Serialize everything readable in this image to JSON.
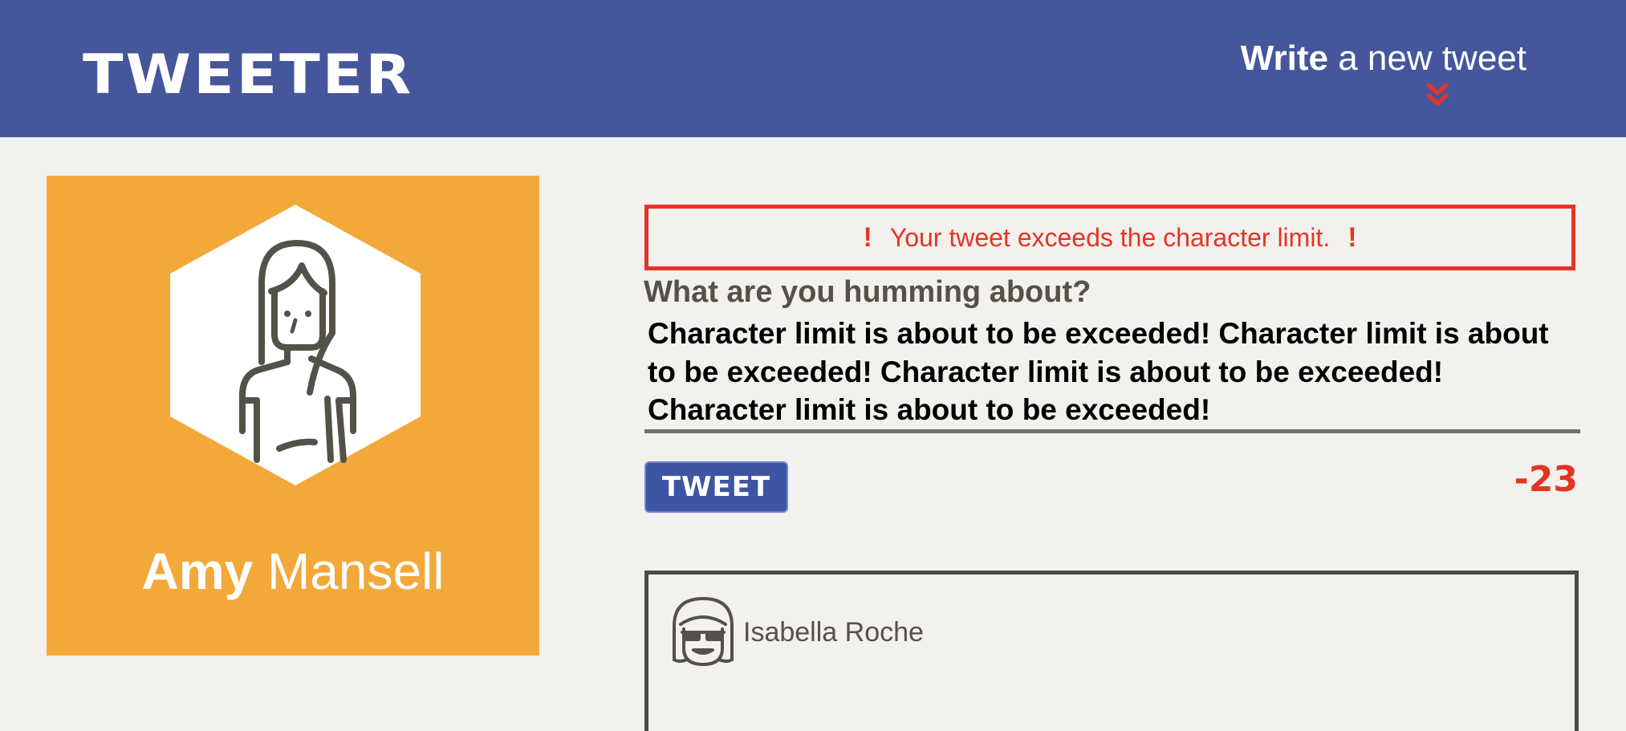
{
  "nav": {
    "logo": "TWEETER",
    "write_strong": "Write",
    "write_rest": " a new tweet",
    "chevron_icon": "double-chevron-down-icon"
  },
  "profile": {
    "first_name": "Amy",
    "last_name": " Mansell",
    "avatar_icon": "user-avatar-icon",
    "background_color": "#f3a83a"
  },
  "compose": {
    "error_bang": "!",
    "error_message": "Your tweet exceeds the character limit.",
    "label": "What are you humming about?",
    "text": "Character limit is about to be exceeded! Character limit is about to be exceeded! Character limit is about to be exceeded! Character limit is about to be exceeded!",
    "button_label": "TWEET",
    "counter": "-23"
  },
  "tweets": [
    {
      "user": "Isabella Roche",
      "avatar_icon": "user-avatar-sunglasses-icon"
    }
  ],
  "colors": {
    "nav": "#45569d",
    "error": "#e53424",
    "background": "#f2f1ed",
    "button": "#3e55a3"
  }
}
